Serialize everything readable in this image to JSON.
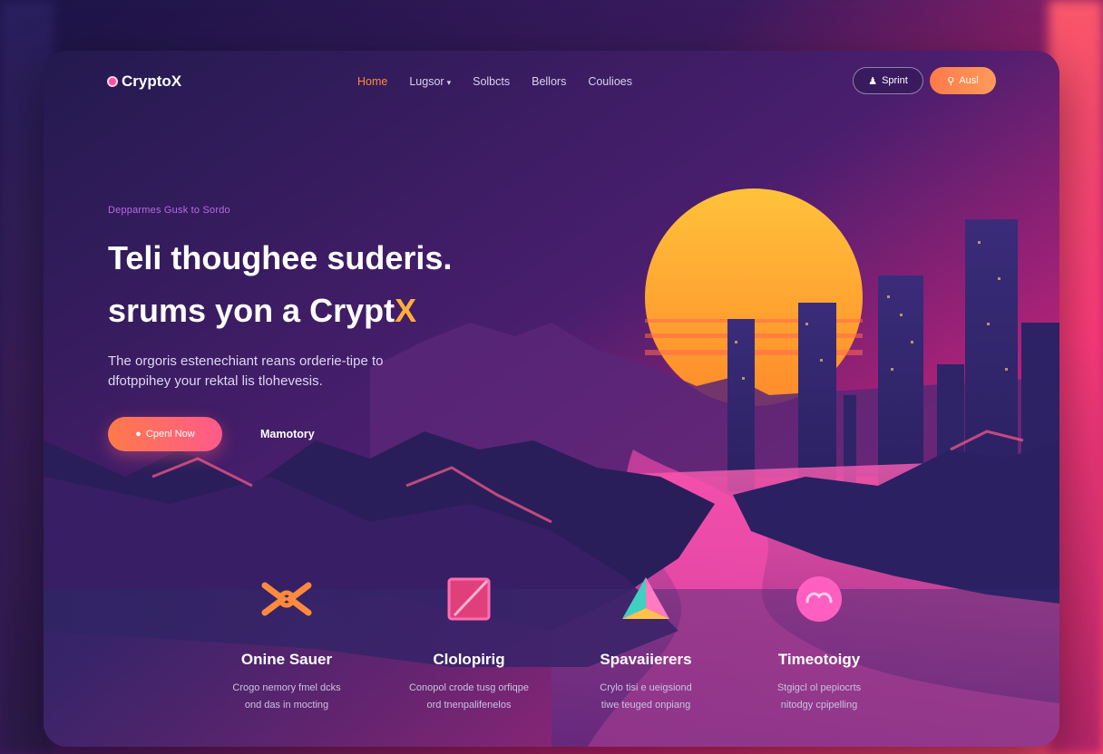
{
  "nav": {
    "logo": "CryptoX",
    "links": [
      {
        "label": "Home",
        "active": true
      },
      {
        "label": "Lugsor",
        "dropdown": true
      },
      {
        "label": "Solbcts"
      },
      {
        "label": "Bellors"
      },
      {
        "label": "Coulioes"
      }
    ],
    "btn_outline": "Sprint",
    "btn_fill": "Ausl"
  },
  "hero": {
    "eyebrow": "Depparmes Gusk to Sordo",
    "headline_line1": "Teli thoughee suderis.",
    "headline_line2_prefix": "srums yon a Crypt",
    "headline_line2_accent": "X",
    "sub_line1": "The orgoris estenechiant reans orderie-tipe to",
    "sub_line2": "dfotppihey your rektal lis tlohevesis.",
    "cta_primary": "Cpenl Now",
    "cta_secondary": "Mamotory"
  },
  "features": [
    {
      "title": "Onine Sauer",
      "desc1": "Crogo nemory fmel dcks",
      "desc2": "ond das in mocting",
      "icon": "crossed-arrows-icon"
    },
    {
      "title": "Clolopirig",
      "desc1": "Conopol crode tusg orfiqpe",
      "desc2": "ord tnenpalifenelos",
      "icon": "square-slash-icon"
    },
    {
      "title": "Spavaiierers",
      "desc1": "Crylo tisi e ueigsiond",
      "desc2": "tiwe teuged onpiang",
      "icon": "prism-icon"
    },
    {
      "title": "Timeotoigy",
      "desc1": "Stgigcl ol pepiocrts",
      "desc2": "nitodgy cpipelling",
      "icon": "cloud-badge-icon"
    }
  ],
  "colors": {
    "accent_orange": "#ff8a3d",
    "accent_pink": "#ff4fa3",
    "sun": "#ffb23a"
  }
}
